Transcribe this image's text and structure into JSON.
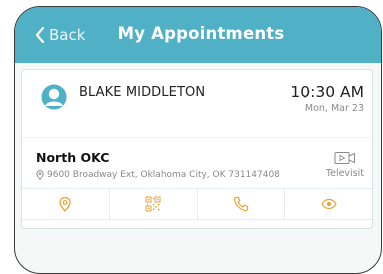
{
  "header": {
    "back_label": "Back",
    "title": "My Appointments"
  },
  "appointment": {
    "patient_name": "BLAKE MIDDLETON",
    "time": "10:30 AM",
    "date": "Mon, Mar 23",
    "location_name": "North OKC",
    "address": "9600 Broadway Ext, Oklahoma City, OK 731147408",
    "visit_type": "Televisit",
    "status_icon": "check-icon"
  },
  "actions": [
    {
      "icon": "map-pin-icon"
    },
    {
      "icon": "qr-code-icon"
    },
    {
      "icon": "phone-icon"
    },
    {
      "icon": "eye-icon"
    }
  ],
  "colors": {
    "header_bg": "#4fb0c6",
    "accent": "#e8a33d",
    "check": "#4caf50"
  }
}
